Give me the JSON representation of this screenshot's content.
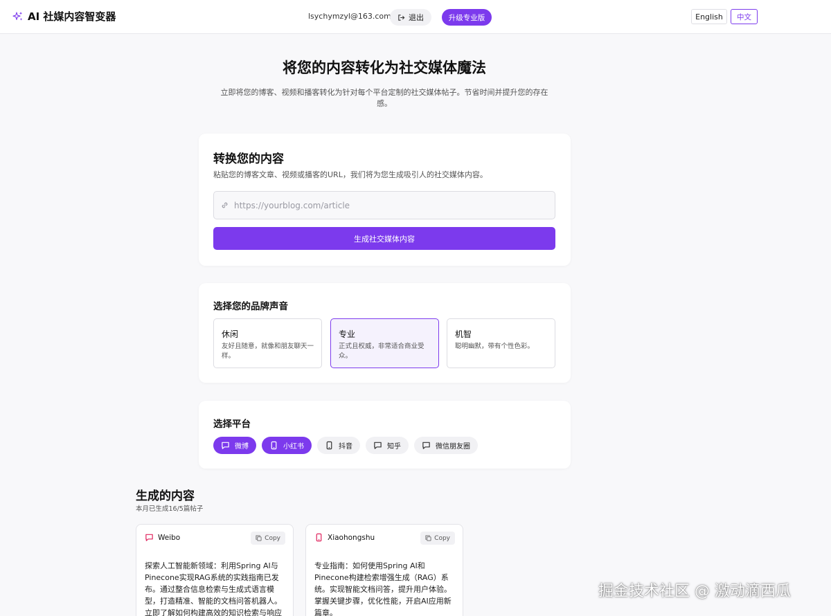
{
  "header": {
    "brand_title": "AI 社媒内容智变器",
    "user_email": "lsychymzyl@163.com",
    "logout_label": "退出",
    "upgrade_label": "升级专业版",
    "lang_en": "English",
    "lang_zh": "中文"
  },
  "hero": {
    "title": "将您的内容转化为社交媒体魔法",
    "subtitle": "立即将您的博客、视频和播客转化为针对每个平台定制的社交媒体帖子。节省时间并提升您的存在感。"
  },
  "convert": {
    "title": "转换您的内容",
    "description": "粘贴您的博客文章、视频或播客的URL，我们将为您生成吸引人的社交媒体内容。",
    "url_placeholder": "https://yourblog.com/article",
    "url_value": "",
    "generate_label": "生成社交媒体内容"
  },
  "voice": {
    "title": "选择您的品牌声音",
    "options": [
      {
        "name": "休闲",
        "desc": "友好且随意，就像和朋友聊天一样。",
        "selected": false
      },
      {
        "name": "专业",
        "desc": "正式且权威，非常适合商业受众。",
        "selected": true
      },
      {
        "name": "机智",
        "desc": "聪明幽默，带有个性色彩。",
        "selected": false
      }
    ]
  },
  "platforms": {
    "title": "选择平台",
    "items": [
      {
        "label": "微博",
        "icon": "chat-bubble-icon",
        "active": true
      },
      {
        "label": "小红书",
        "icon": "phone-icon",
        "active": true
      },
      {
        "label": "抖音",
        "icon": "phone-icon",
        "active": false
      },
      {
        "label": "知乎",
        "icon": "chat-bubble-icon",
        "active": false
      },
      {
        "label": "微信朋友圈",
        "icon": "chat-bubble-icon",
        "active": false
      }
    ]
  },
  "generated": {
    "title": "生成的内容",
    "count_text": "本月已生成16/5篇帖子",
    "posts": [
      {
        "platform": "Weibo",
        "icon": "chat-bubble-icon",
        "color": "#e0245e",
        "copy_label": "Copy",
        "text": "探索人工智能新领域：利用Spring AI与Pinecone实现RAG系统的实践指南已发布。通过整合信息检索与生成式语言模型，打造精准、智能的文档问答机器人。立即了解如何构建高效的知识检索与响应"
      },
      {
        "platform": "Xiaohongshu",
        "icon": "phone-icon",
        "color": "#e0245e",
        "copy_label": "Copy",
        "text": "专业指南：如何使用Spring AI和Pinecone构建检索增强生成（RAG）系统。实现智能文档问答，提升用户体验。掌握关键步骤，优化性能，开启AI应用新篇章。"
      }
    ]
  },
  "watermark": "掘金技术社区 @ 激动滴西瓜",
  "colors": {
    "accent": "#7c3aed",
    "post_icon": "#e0245e"
  }
}
